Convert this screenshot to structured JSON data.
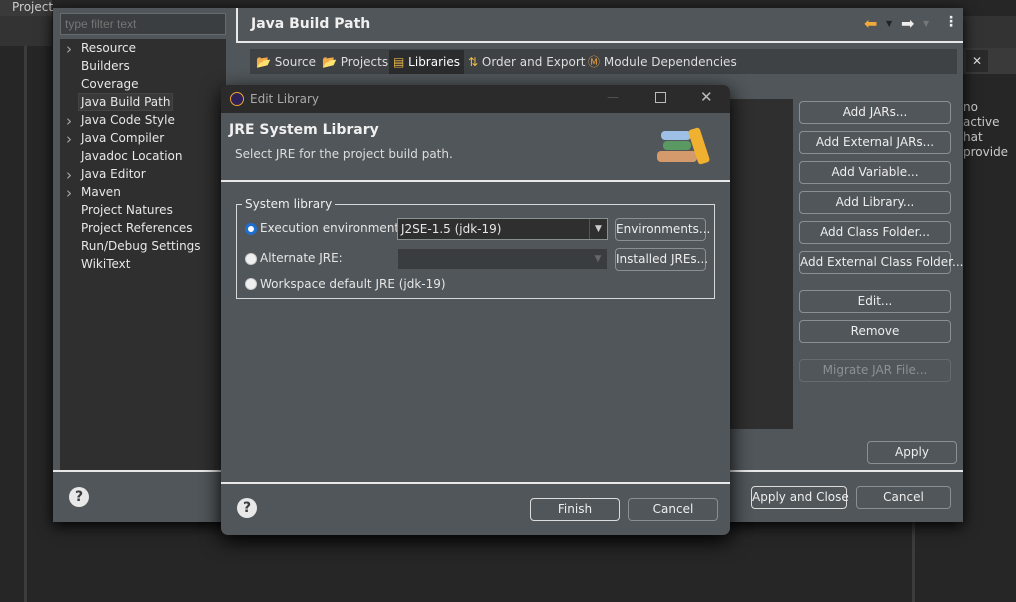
{
  "background": {
    "project_label": "Project",
    "right_text": [
      "no active",
      "hat provide"
    ]
  },
  "prefs": {
    "filter_placeholder": "type filter text",
    "tree": [
      {
        "label": "Resource",
        "expandable": true
      },
      {
        "label": "Builders",
        "expandable": false
      },
      {
        "label": "Coverage",
        "expandable": false
      },
      {
        "label": "Java Build Path",
        "expandable": false,
        "selected": true
      },
      {
        "label": "Java Code Style",
        "expandable": true
      },
      {
        "label": "Java Compiler",
        "expandable": true
      },
      {
        "label": "Javadoc Location",
        "expandable": false
      },
      {
        "label": "Java Editor",
        "expandable": true
      },
      {
        "label": "Maven",
        "expandable": true
      },
      {
        "label": "Project Natures",
        "expandable": false
      },
      {
        "label": "Project References",
        "expandable": false
      },
      {
        "label": "Run/Debug Settings",
        "expandable": false
      },
      {
        "label": "WikiText",
        "expandable": false
      }
    ],
    "title": "Java Build Path",
    "tabs": [
      "Source",
      "Projects",
      "Libraries",
      "Order and Export",
      "Module Dependencies"
    ],
    "active_tab": "Libraries",
    "side_buttons": [
      "Add JARs...",
      "Add External JARs...",
      "Add Variable...",
      "Add Library...",
      "Add Class Folder...",
      "Add External Class Folder...",
      "Edit...",
      "Remove",
      "Migrate JAR File..."
    ],
    "apply": "Apply",
    "apply_close": "Apply and Close",
    "cancel": "Cancel"
  },
  "dialog": {
    "window_title": "Edit Library",
    "heading": "JRE System Library",
    "description": "Select JRE for the project build path.",
    "group_label": "System library",
    "options": {
      "exec_env": "Execution environment:",
      "alt_jre": "Alternate JRE:",
      "workspace": "Workspace default JRE (jdk-19)"
    },
    "selected_option": "exec_env",
    "exec_env_value": "J2SE-1.5 (jdk-19)",
    "alt_jre_value": "",
    "environments_button": "Environments...",
    "installed_jres_button": "Installed JREs...",
    "finish": "Finish",
    "cancel": "Cancel",
    "accent": "#1f6fd1"
  }
}
